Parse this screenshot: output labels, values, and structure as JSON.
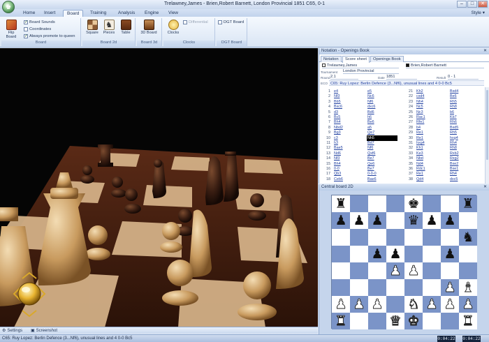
{
  "window": {
    "title": "Trelawney,James - Brien,Robert Barnett, London Provincial 1851  C65, 0-1",
    "min": "–",
    "max": "□",
    "close": "✕"
  },
  "ribbon_tabs": [
    "Home",
    "Insert",
    "Board",
    "Training",
    "Analysis",
    "Engine",
    "View"
  ],
  "style_menu": "Style ▾",
  "ribbon": {
    "flip_board": "Flip Board",
    "board_sounds": "Board Sounds",
    "coordinates": "Coordinates",
    "always_promote": "Always promote to queen",
    "group_board": "Board",
    "square": "Square",
    "pieces": "Pieces",
    "table": "Table",
    "group_board2d": "Board 2d",
    "board3d_btn": "3D Board",
    "group_board3d": "Board 3d",
    "clocks": "Clocks",
    "differential": "Differential",
    "group_clocks": "Clocks",
    "dgt_board": "DGT Board",
    "group_dgt": "DGT Board"
  },
  "notation": {
    "pane_title": "Notation - Openings Book",
    "tabs": [
      "Notation",
      "Score sheet",
      "Openings Book"
    ],
    "white": "Trelawney,James",
    "black": "Brien,Robert Barnett",
    "tournament_label": "Tournament",
    "tournament": "London Provincial",
    "round_label": "Round",
    "round": "2.1",
    "date_label": "Date",
    "date": "1851",
    "result_label": "Result",
    "result": "0 - 1",
    "eco_label": "ECO",
    "opening": "C65: Ruy Lopez: Berlin Defence (3...Nf6), unusual lines and 4 0-0 Bc5",
    "moves_left": [
      {
        "n": "1",
        "w": "e4",
        "b": "e5"
      },
      {
        "n": "2",
        "w": "Nf3",
        "b": "Nc6"
      },
      {
        "n": "3",
        "w": "Bb5",
        "b": "Nf6"
      },
      {
        "n": "4",
        "w": "Bxc6",
        "b": "dxc6"
      },
      {
        "n": "5",
        "w": "d3",
        "b": "Bd6"
      },
      {
        "n": "6",
        "w": "Bc5",
        "b": "h6"
      },
      {
        "n": "7",
        "w": "Bh4",
        "b": "Be6"
      },
      {
        "n": "8",
        "w": "Nbd2",
        "b": "a5"
      },
      {
        "n": "9",
        "w": "Bg3",
        "b": "Qe7"
      },
      {
        "n": "10",
        "w": "c3",
        "b": "Nh5"
      },
      {
        "n": "11",
        "w": "h3",
        "b": "Bd7"
      },
      {
        "n": "12",
        "w": "Bae5",
        "b": "Nf6"
      },
      {
        "n": "13",
        "w": "Nd6",
        "b": "Qxf6"
      },
      {
        "n": "14",
        "w": "Nf3",
        "b": "Be7"
      },
      {
        "n": "15",
        "w": "Bh4",
        "b": "Qe6"
      },
      {
        "n": "16",
        "w": "0-0",
        "b": "Be7"
      },
      {
        "n": "17",
        "w": "Qb3",
        "b": "0-0-0"
      },
      {
        "n": "18",
        "w": "Ceb6",
        "b": "Bae6"
      }
    ],
    "moves_right": [
      {
        "n": "21",
        "w": "Kh2",
        "b": "Bxd4"
      },
      {
        "n": "22",
        "w": "cxd4",
        "b": "Be6"
      },
      {
        "n": "23",
        "w": "Nh4",
        "b": "Rh5"
      },
      {
        "n": "24",
        "w": "Nc5",
        "b": "Rh8"
      },
      {
        "n": "25",
        "w": "Nc3",
        "b": "b6"
      },
      {
        "n": "26",
        "w": "Rac1",
        "b": "Kb7"
      },
      {
        "n": "27",
        "w": "Rfe1",
        "b": "Rh6"
      },
      {
        "n": "28",
        "w": "b4",
        "b": "Bxd5"
      },
      {
        "n": "29",
        "w": "Re1",
        "b": "Rh5"
      },
      {
        "n": "30",
        "w": "Re1",
        "b": "hxg4"
      },
      {
        "n": "31",
        "w": "hxg4",
        "b": "Rh4"
      },
      {
        "n": "32",
        "w": "Kh1",
        "b": "Rh8"
      },
      {
        "n": "33",
        "w": "Ke3",
        "b": "Rxb2"
      },
      {
        "n": "34",
        "w": "Nbd",
        "b": "Rxg2"
      },
      {
        "n": "35",
        "w": "Nd4",
        "b": "Bxe2"
      },
      {
        "n": "36",
        "w": "Rdc1",
        "b": "Bxe1"
      },
      {
        "n": "37",
        "w": "Re1",
        "b": "Rh4"
      },
      {
        "n": "38",
        "w": "Qd4",
        "b": "dxc5"
      }
    ],
    "current_move": "Nh5"
  },
  "board2d": {
    "title": "Central board 2D",
    "rows": [
      [
        "r",
        "",
        "",
        "",
        "k",
        "",
        "",
        "r"
      ],
      [
        "p",
        "p",
        "p",
        "",
        "q",
        "p",
        "p",
        ""
      ],
      [
        "",
        "",
        "",
        "",
        "",
        "",
        "",
        "n"
      ],
      [
        "",
        "",
        "p",
        "p",
        "",
        "",
        "p",
        ""
      ],
      [
        "",
        "",
        "",
        "P",
        "P",
        "",
        "",
        ""
      ],
      [
        "",
        "",
        "",
        "",
        "",
        "",
        "P",
        "B"
      ],
      [
        "P",
        "P",
        "P",
        "",
        "N",
        "P",
        "P",
        "P"
      ],
      [
        "R",
        "",
        "",
        "Q",
        "K",
        "",
        "",
        "R"
      ]
    ]
  },
  "bottom_tabs": {
    "settings": "Settings",
    "screenshot": "Screenshot"
  },
  "status": {
    "text": "C65: Ruy Lopez: Berlin Defence (3...Nf6), unusual lines and 4 0-0 Bc5",
    "clock_white": "0:04:22",
    "clock_black": "0:04:22"
  }
}
